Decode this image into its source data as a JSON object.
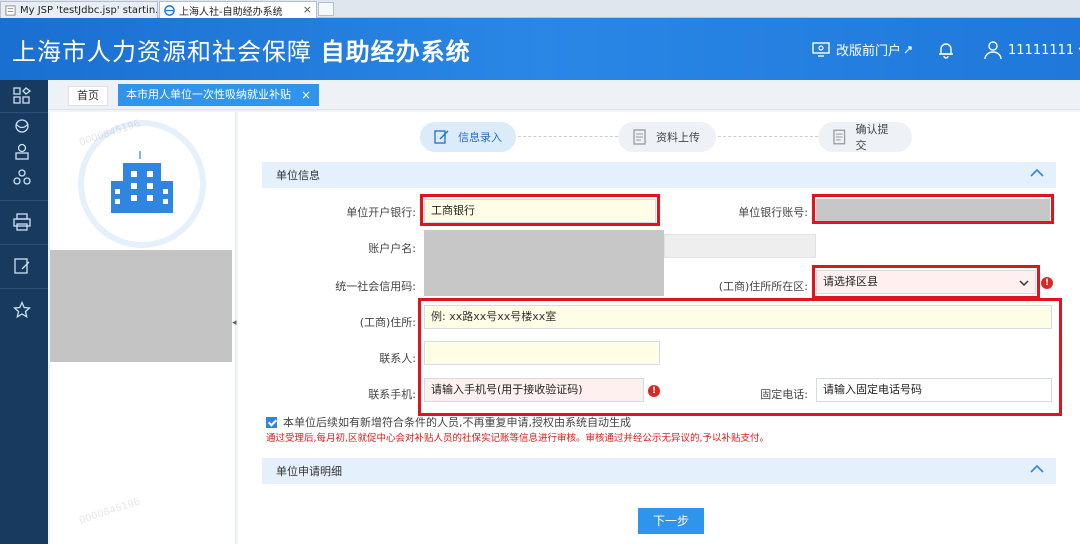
{
  "browser": {
    "tabs": [
      {
        "label": "My JSP 'testJdbc.jsp' startin...",
        "active": false
      },
      {
        "label": "上海人社-自助经办系统",
        "active": true
      }
    ]
  },
  "header": {
    "title_main": "上海市人力资源和社会保障",
    "title_bold": "自助经办系统",
    "legacy_portal": "改版前门户",
    "username": "11111111"
  },
  "breadcrumb": {
    "home": "首页",
    "active_tab": "本市用人单位一次性吸纳就业补贴",
    "close": "×"
  },
  "stepper": {
    "steps": [
      "信息录入",
      "资料上传",
      "确认提交"
    ]
  },
  "watermark": "0000845196",
  "section_unit": {
    "title": "单位信息",
    "bank_label": "单位开户银行:",
    "bank_value": "工商银行",
    "account_label": "单位银行账号:",
    "holder_label": "账户户名:",
    "credit_code_label": "统一社会信用码:",
    "district_label": "(工商)住所所在区:",
    "district_value": "请选择区县",
    "address_label": "(工商)住所:",
    "address_placeholder": "例: xx路xx号xx号楼xx室",
    "contact_label": "联系人:",
    "mobile_label": "联系手机:",
    "mobile_placeholder": "请输入手机号(用于接收验证码)",
    "phone_label": "固定电话:",
    "phone_placeholder": "请输入固定电话号码",
    "checkbox_text": "本单位后续如有新增符合条件的人员,不再重复申请,授权由系统自动生成",
    "notice": "通过受理后,每月初,区就促中心会对补贴人员的社保实记账等信息进行审核。审核通过并经公示无异议的,予以补贴支付。"
  },
  "section_detail": {
    "title": "单位申请明细"
  },
  "actions": {
    "next": "下一步"
  },
  "colors": {
    "header_blue": "#2a87e6",
    "sidebar": "#173a5e",
    "accent": "#2f95ec",
    "highlight_red": "#e0141e"
  }
}
